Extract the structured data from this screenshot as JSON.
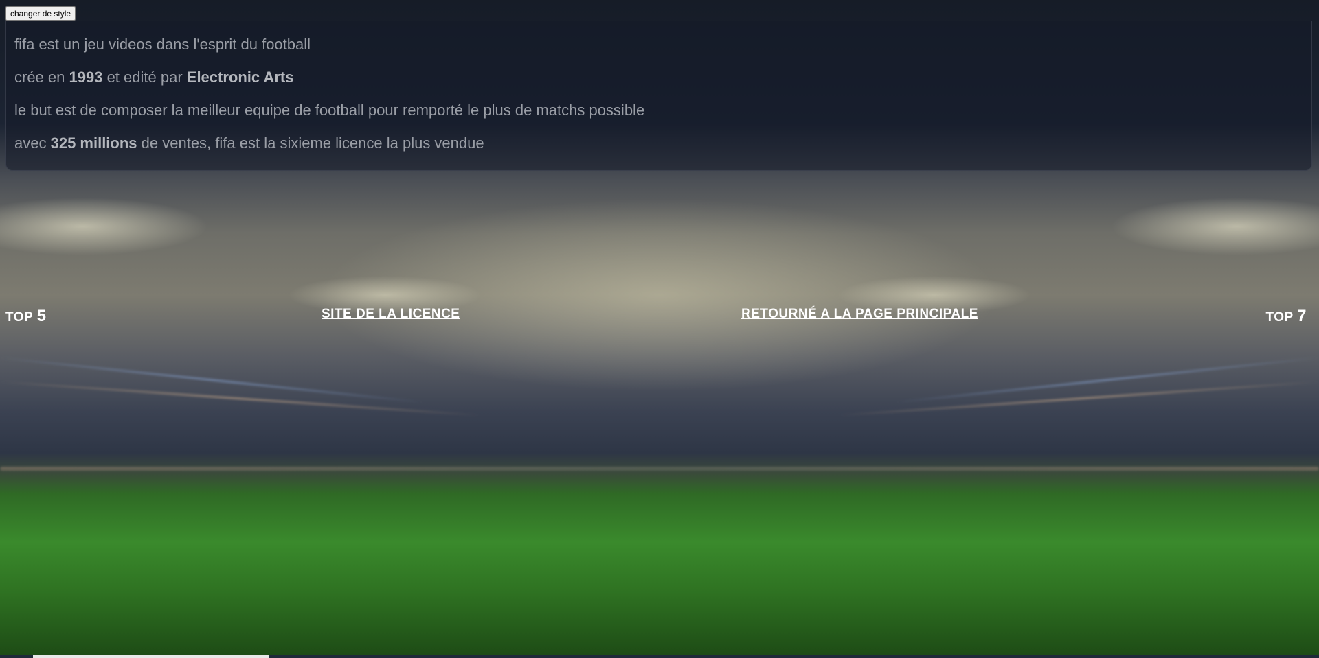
{
  "style_button": {
    "label": "changer de style"
  },
  "info": {
    "line1": {
      "text": "fifa est un jeu videos dans l'esprit du football"
    },
    "line2": {
      "pre": "crée en ",
      "year": "1993",
      "mid": " et edité par ",
      "publisher": "Electronic Arts"
    },
    "line3": {
      "text": "le but est de composer la meilleur equipe de football pour remporté le plus de matchs possible"
    },
    "line4": {
      "pre": "avec ",
      "sales": "325 millions",
      "post": " de ventes, fifa est la sixieme licence la plus vendue"
    }
  },
  "nav": {
    "top5": {
      "word": "top ",
      "num": "5"
    },
    "licence": "site de la licence",
    "home": "retourné a la page principale",
    "top7": {
      "word": "top ",
      "num": "7"
    }
  },
  "colors": {
    "panel_bg": "#141a28",
    "panel_text": "#9a9ea6",
    "link": "#ffffff",
    "grass": "#3a8a2c"
  },
  "background": {
    "icon": "stadium-pitch-background"
  }
}
